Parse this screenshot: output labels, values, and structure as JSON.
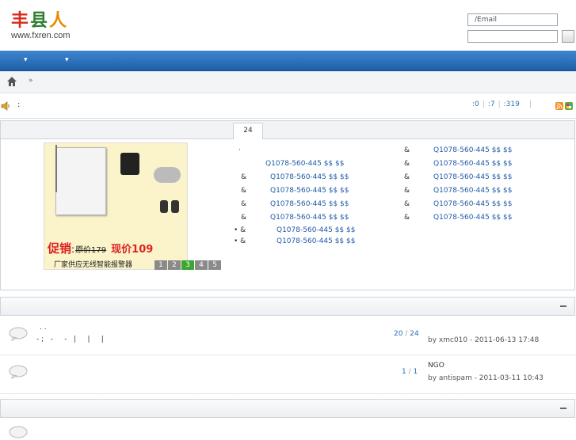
{
  "header": {
    "logo_cn": [
      "丰",
      "县",
      "人"
    ],
    "logo_url": "www.fxren.com",
    "login_placeholder": "/Email"
  },
  "breadcrumb": {
    "sep": "»"
  },
  "notice": {
    "colon": ":"
  },
  "stats": {
    "a": ":0",
    "b": ":7",
    "c": ":319",
    "sep": "|"
  },
  "showcase": {
    "tab_label": "24",
    "promo": {
      "promo_word": "促销",
      "colon": ":",
      "old_price": "原价179",
      "new_price": "现价109",
      "footer": "厂家供应无线智能报警器",
      "pages": [
        "1",
        "2",
        "3",
        "4",
        "5"
      ],
      "active_page": 3
    },
    "left_links": [
      {
        "prefix": "·",
        "text": ""
      },
      {
        "prefix": "",
        "text": "Q1078-560-445 $$ $$"
      },
      {
        "prefix": "&",
        "text": "Q1078-560-445 $$ $$"
      },
      {
        "prefix": "&",
        "text": "Q1078-560-445 $$ $$"
      },
      {
        "prefix": "&",
        "text": "Q1078-560-445 $$ $$"
      },
      {
        "prefix": "&",
        "text": "Q1078-560-445 $$ $$"
      },
      {
        "prefix": "• &",
        "text": "Q1078-560-445 $$ $$"
      },
      {
        "prefix": "• &",
        "text": "Q1078-560-445 $$ $$"
      }
    ],
    "right_links": [
      {
        "prefix": "&",
        "text": "Q1078-560-445 $$ $$"
      },
      {
        "prefix": "&",
        "text": "Q1078-560-445 $$ $$"
      },
      {
        "prefix": "&",
        "text": "Q1078-560-445 $$ $$"
      },
      {
        "prefix": "&",
        "text": "Q1078-560-445 $$ $$"
      },
      {
        "prefix": "&",
        "text": "Q1078-560-445 $$ $$"
      },
      {
        "prefix": "&",
        "text": "Q1078-560-445 $$ $$"
      }
    ]
  },
  "forum": {
    "rows": [
      {
        "title": ". .",
        "desc": "- ;   -     -   |     |     |",
        "posts": "20",
        "replies": "24",
        "lastpost": "by xmc010 - 2011-06-13 17:48"
      },
      {
        "title": "",
        "desc": "",
        "posts": "1",
        "replies": "1",
        "lastpost_title": "NGO",
        "lastpost": "by antispam - 2011-03-11 10:43"
      }
    ],
    "slash": "/"
  },
  "colors": {
    "nav": "#1d5fa8",
    "link": "#1e5aa8",
    "accent_green": "#3aa635"
  }
}
